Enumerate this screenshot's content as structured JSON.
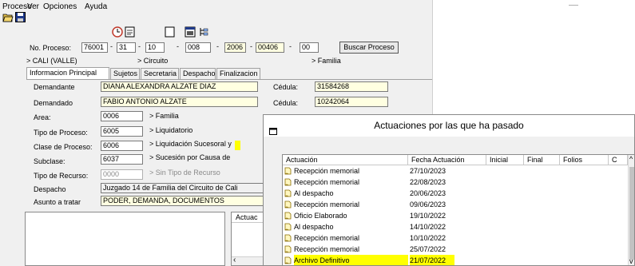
{
  "menu": [
    "Proceso",
    "Ver",
    "Opciones",
    "Ayuda"
  ],
  "process": {
    "label": "No. Proceso:",
    "parts": [
      "76001",
      "31",
      "10",
      "008",
      "2006",
      "00406",
      "00"
    ],
    "search_button": "Buscar Proceso",
    "city": "> CALI (VALLE)",
    "circuit": "> Circuito",
    "family": "> Familia"
  },
  "tabs": [
    "Informacion Principal",
    "Sujetos",
    "Secretaria",
    "Despacho",
    "Finalizacion"
  ],
  "form": {
    "demandante_label": "Demandante",
    "demandante": "DIANA ALEXANDRA ALZATE DIAZ",
    "cedula_label": "Cédula:",
    "cedula1": "31584268",
    "demandado_label": "Demandado",
    "demandado": "FABIO ANTONIO ALZATE",
    "cedula2": "10242064",
    "area_label": "Area:",
    "area_code": "0006",
    "area_text": "> Familia",
    "tipo_label": "Tipo de Proceso:",
    "tipo_code": "6005",
    "tipo_text": "> Liquidatorio",
    "clase_label": "Clase de Proceso:",
    "clase_code": "6006",
    "clase_text": "> Liquidación Sucesoral y",
    "subclase_label": "Subclase:",
    "subclase_code": "6037",
    "subclase_text": "> Sucesión por Causa de",
    "recurso_label": "Tipo de Recurso:",
    "recurso_code": "0000",
    "recurso_text": "> Sin Tipo de Recurso",
    "despacho_label": "Despacho",
    "despacho": "Juzgado 14 de Familia del Circuito de Cali",
    "asunto_label": "Asunto a tratar",
    "asunto": "PODER, DEMANDA, DOCUMENTOS"
  },
  "lower_panel_header": "Actuac",
  "dialog": {
    "title": "Actuaciones por las que ha pasado",
    "columns": [
      "Actuación",
      "Fecha Actuación",
      "Inicial",
      "Final",
      "Folios",
      "C"
    ],
    "rows": [
      {
        "actuacion": "Recepción memorial",
        "fecha": "27/10/2023",
        "highlight": false
      },
      {
        "actuacion": "Recepción memorial",
        "fecha": "22/08/2023",
        "highlight": false
      },
      {
        "actuacion": "Al despacho",
        "fecha": "20/06/2023",
        "highlight": false
      },
      {
        "actuacion": "Recepción memorial",
        "fecha": "09/06/2023",
        "highlight": false
      },
      {
        "actuacion": "Oficio Elaborado",
        "fecha": "19/10/2022",
        "highlight": false
      },
      {
        "actuacion": "Al despacho",
        "fecha": "14/10/2022",
        "highlight": false
      },
      {
        "actuacion": "Recepción memorial",
        "fecha": "10/10/2022",
        "highlight": false
      },
      {
        "actuacion": "Recepción memorial",
        "fecha": "25/07/2022",
        "highlight": false
      },
      {
        "actuacion": "Archivo Definitivo",
        "fecha": "21/07/2022",
        "highlight": true
      }
    ]
  },
  "colors": {
    "highlight": "#ffff00",
    "field_yellow": "#ffffe1",
    "window_bg": "#f0f0f0"
  }
}
